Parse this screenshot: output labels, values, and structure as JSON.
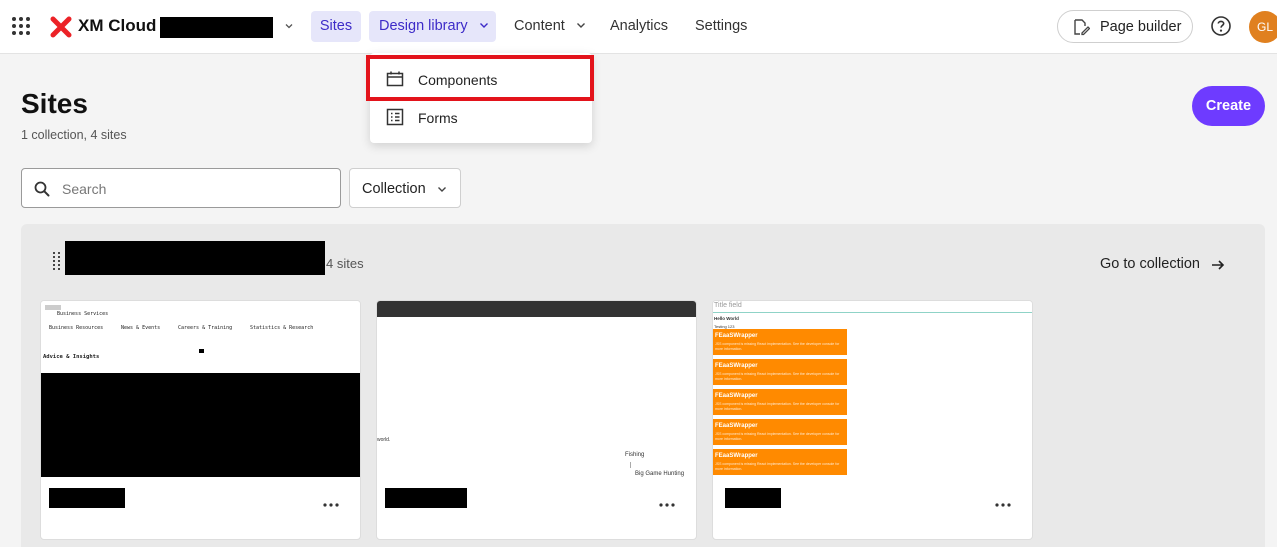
{
  "app": {
    "brand": "XM Cloud",
    "user_initials": "GL"
  },
  "nav": {
    "items": [
      {
        "label": "Sites",
        "active": true
      },
      {
        "label": "Design library",
        "highlighted": true
      },
      {
        "label": "Content"
      },
      {
        "label": "Analytics"
      },
      {
        "label": "Settings"
      }
    ],
    "page_builder_label": "Page builder"
  },
  "dropdown": {
    "items": [
      {
        "label": "Components",
        "icon": "component-icon"
      },
      {
        "label": "Forms",
        "icon": "form-list-icon"
      }
    ]
  },
  "page": {
    "title": "Sites",
    "subtitle": "1 collection, 4 sites",
    "create_label": "Create",
    "search_placeholder": "Search",
    "collection_filter_label": "Collection"
  },
  "collection": {
    "count_label": "4 sites",
    "goto_label": "Go to collection"
  },
  "cards": {
    "card1": {
      "nav_label": "Business Services",
      "links": [
        "Business Resources",
        "News & Events",
        "Careers & Training",
        "Statistics & Research"
      ],
      "section": "Advice & Insights"
    },
    "card2": {
      "text_world": "world.",
      "text_fishing": "Fishing",
      "text_hunting": "Big Game Hunting"
    },
    "card3": {
      "title_field": "Title field",
      "hello": "Hello World",
      "small": "Testing 123",
      "wrapper_title": "FEaaSWrapper",
      "wrapper_text": "JSS component is missing React implementation. See the developer console for more information."
    }
  },
  "colors": {
    "accent": "#6e3bff",
    "nav_active_bg": "#e6e6fa",
    "highlight": "#e3131b",
    "avatar": "#e0801f",
    "orange_block": "#ff8a00"
  }
}
